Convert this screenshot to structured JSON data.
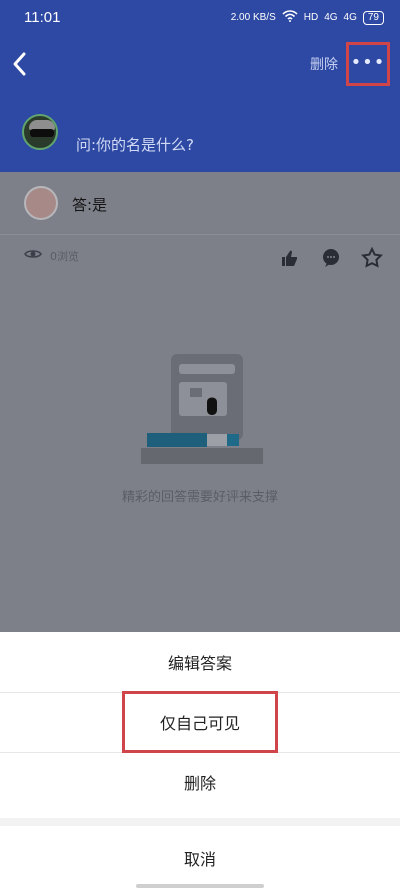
{
  "status_bar": {
    "time": "11:01",
    "speed": "2.00 KB/S",
    "network": "HD",
    "signal_1": "4G",
    "signal_2": "4G",
    "battery": "79"
  },
  "header": {
    "back_icon": "chevron-left-icon",
    "delete_label": "删除",
    "more_icon": "more-horizontal-icon",
    "question_user": "",
    "question_text": "问:你的名是什么?"
  },
  "answer": {
    "text": "答:是",
    "views": "0浏览"
  },
  "actions": {
    "like_icon": "thumbs-up-icon",
    "comment_icon": "comment-icon",
    "favorite_icon": "star-icon"
  },
  "empty_state": {
    "text": "精彩的回答需要好评来支撑"
  },
  "bottom_sheet": {
    "items": [
      {
        "label": "编辑答案"
      },
      {
        "label": "仅自己可见"
      },
      {
        "label": "删除"
      },
      {
        "label": "取消"
      }
    ]
  },
  "colors": {
    "brand_blue": "#2e49a3",
    "highlight_red": "#d04549",
    "overlay_gray": "#7e8089"
  }
}
